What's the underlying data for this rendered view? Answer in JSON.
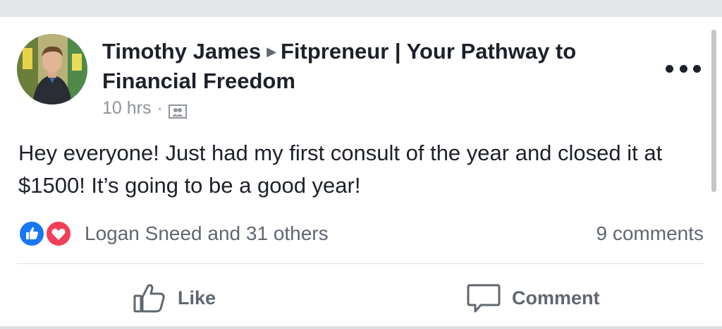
{
  "post": {
    "author": "Timothy James",
    "group": "Fitpreneur | Your Pathway to Financial Freedom",
    "time": "10 hrs",
    "separator": "·",
    "text": "Hey everyone! Just had my first consult of the year and closed it at $1500! It’s going to be a good year!"
  },
  "reactions": {
    "summary": "Logan Sneed and 31 others",
    "types": [
      "like",
      "love"
    ],
    "like_color": "#1877f2",
    "love_color": "#f33e58"
  },
  "comments": {
    "count_label": "9 comments"
  },
  "actions": {
    "like_label": "Like",
    "comment_label": "Comment"
  },
  "icons": {
    "audience": "group-icon",
    "more": "more-options-icon",
    "like": "thumbs-up-icon",
    "comment": "speech-bubble-icon"
  }
}
